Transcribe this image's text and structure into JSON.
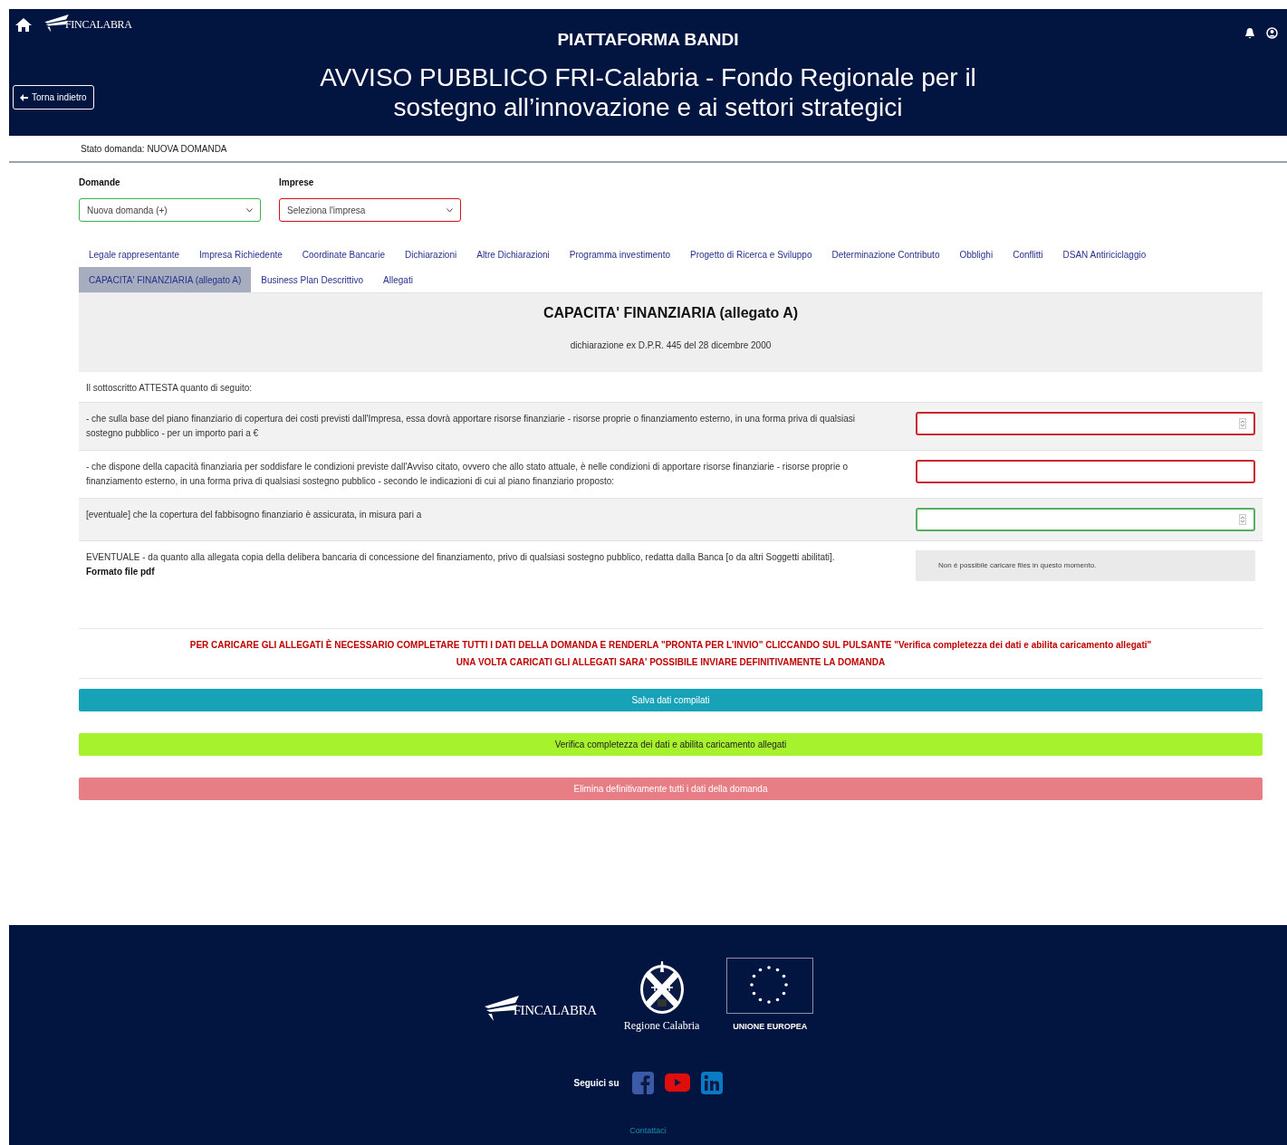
{
  "header": {
    "logo_text": "FINCALABRA",
    "platform_title": "PIATTAFORMA BANDI",
    "back_button": "Torna indietro",
    "title": "AVVISO PUBBLICO FRI-Calabria - Fondo Regionale per il sostegno all’innovazione e ai settori strategici"
  },
  "status": "Stato domanda: NUOVA DOMANDA",
  "selects": [
    {
      "label": "Domande",
      "value": "Nuova domanda (+)",
      "valid": true
    },
    {
      "label": "Imprese",
      "value": "Seleziona l'impresa",
      "valid": false
    }
  ],
  "tabs": [
    {
      "label": "Legale rappresentante",
      "selected": false
    },
    {
      "label": "Impresa Richiedente",
      "selected": false
    },
    {
      "label": "Coordinate Bancarie",
      "selected": false
    },
    {
      "label": "Dichiarazioni",
      "selected": false
    },
    {
      "label": "Altre Dichiarazioni",
      "selected": false
    },
    {
      "label": "Programma investimento",
      "selected": false
    },
    {
      "label": "Progetto di Ricerca e Sviluppo",
      "selected": false
    },
    {
      "label": "Determinazione Contributo",
      "selected": false
    },
    {
      "label": "Obblighi",
      "selected": false
    },
    {
      "label": "Conflitti",
      "selected": false
    },
    {
      "label": "DSAN Antiriciclaggio",
      "selected": false
    },
    {
      "label": "CAPACITA' FINANZIARIA (allegato A)",
      "selected": true
    },
    {
      "label": "Business Plan Descrittivo",
      "selected": false
    },
    {
      "label": "Allegati",
      "selected": false
    }
  ],
  "section": {
    "title": "CAPACITA' FINANZIARIA (allegato A)",
    "subtitle": "dichiarazione ex D.P.R. 445 del 28 dicembre 2000"
  },
  "intro": "Il sottoscritto ATTESTA quanto di seguito:",
  "rows": [
    {
      "kind": "number",
      "text": "- che sulla base del piano finanziario di copertura dei costi previsti dall'Impresa, essa dovrà apportare risorse finanziarie - risorse proprie o finanziamento esterno, in una forma priva di qualsiasi sostegno pubblico - per un importo pari a €",
      "valid": false
    },
    {
      "kind": "text",
      "text": "- che dispone della capacità finanziaria per soddisfare le condizioni previste dall'Avviso citato, ovvero che allo stato attuale, è nelle condizioni di apportare risorse finanziarie - risorse proprie o finanziamento esterno, in una forma priva di qualsiasi sostegno pubblico - secondo le indicazioni di cui al piano finanziario proposto:",
      "valid": false
    },
    {
      "kind": "number",
      "text": "[eventuale] che la copertura del fabbisogno finanziario è assicurata, in misura pari a",
      "valid": true
    },
    {
      "kind": "upload",
      "text": "EVENTUALE - da quanto alla allegata copia della delibera bancaria di concessione del finanziamento, privo di qualsiasi sostegno pubblico, redatta dalla Banca [o da altri Soggetti abilitati].",
      "note": "Formato file pdf",
      "message": "Non è possibile caricare files in questo momento."
    }
  ],
  "warning": [
    "PER CARICARE GLI ALLEGATI È NECESSARIO COMPLETARE TUTTI I DATI DELLA DOMANDA E RENDERLA \"PRONTA PER L'INVIO\" CLICCANDO SUL PULSANTE \"Verifica completezza dei dati e abilita caricamento allegati\"",
    "UNA VOLTA CARICATI GLI ALLEGATI SARA' POSSIBILE INVIARE DEFINITIVAMENTE LA DOMANDA"
  ],
  "buttons": [
    {
      "kind": "save",
      "label": "Salva dati compilati"
    },
    {
      "kind": "verify",
      "label": "Verifica completezza dei dati e abilita caricamento allegati"
    },
    {
      "kind": "delete",
      "label": "Elimina definitivamente tutti i dati della domanda"
    }
  ],
  "footer": {
    "logo_text": "FINCALABRA",
    "region_text": "Regione Calabria",
    "eu_text": "UNIONE EUROPEA",
    "follow": "Seguici su",
    "contact": "Contattaci"
  }
}
